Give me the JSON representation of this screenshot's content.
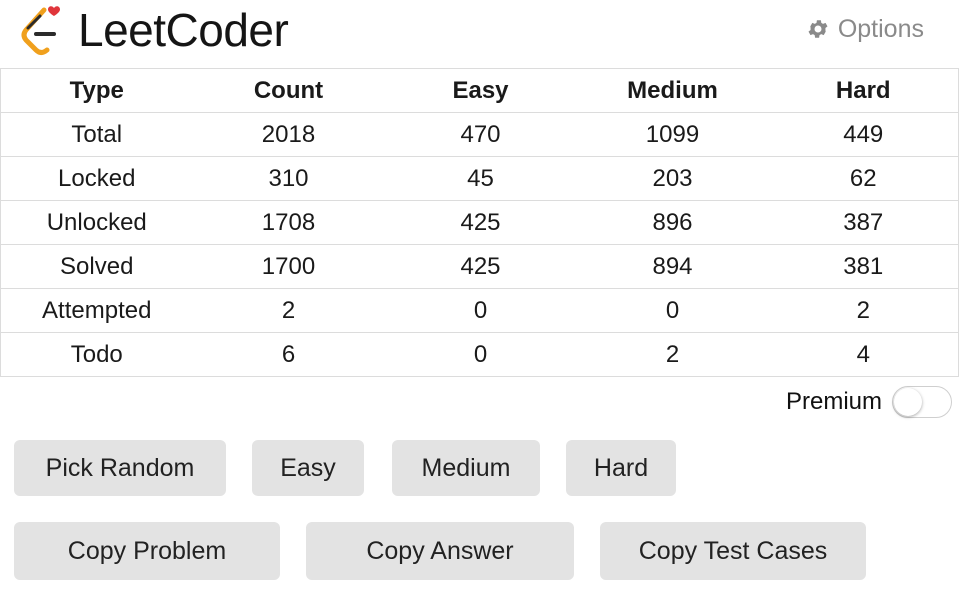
{
  "header": {
    "app_title": "LeetCoder",
    "options_label": "Options",
    "logo_icon": "leetcode-logo-icon",
    "options_icon": "gear-icon",
    "colors": {
      "logo_orange": "#f0a01d",
      "logo_dark": "#2b2b2b",
      "logo_heart": "#e0353b",
      "options_text": "#8a8a8a"
    }
  },
  "table": {
    "columns": [
      "Type",
      "Count",
      "Easy",
      "Medium",
      "Hard"
    ],
    "rows": [
      [
        "Total",
        "2018",
        "470",
        "1099",
        "449"
      ],
      [
        "Locked",
        "310",
        "45",
        "203",
        "62"
      ],
      [
        "Unlocked",
        "1708",
        "425",
        "896",
        "387"
      ],
      [
        "Solved",
        "1700",
        "425",
        "894",
        "381"
      ],
      [
        "Attempted",
        "2",
        "0",
        "0",
        "2"
      ],
      [
        "Todo",
        "6",
        "0",
        "2",
        "4"
      ]
    ]
  },
  "premium": {
    "label": "Premium",
    "enabled": false
  },
  "buttons": {
    "pick_random": "Pick Random",
    "easy": "Easy",
    "medium": "Medium",
    "hard": "Hard",
    "copy_problem": "Copy Problem",
    "copy_answer": "Copy Answer",
    "copy_test_cases": "Copy Test Cases"
  },
  "colors": {
    "button_bg": "#e3e3e3",
    "border": "#dcdcdc"
  }
}
